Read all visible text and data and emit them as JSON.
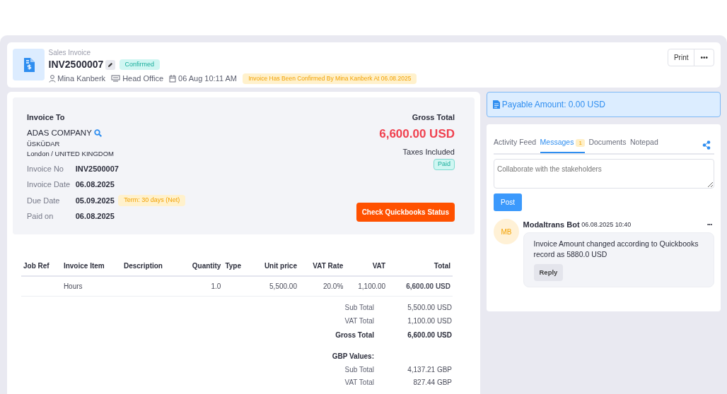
{
  "header": {
    "doc_type": "Sales Invoice",
    "number": "INV2500007",
    "status": "Confirmed",
    "user": "Mina Kanberk",
    "office": "Head Office",
    "datetime": "06 Aug 10:11 AM",
    "notice": "Invoice Has Been Confirmed By Mina Kanberk At 06.08.2025"
  },
  "actions": [
    "Print",
    "•••"
  ],
  "bill_to": {
    "heading": "Invoice To",
    "company": "ADAS COMPANY",
    "lines": [
      "ÜSKÜDAR",
      "London / UNITED KINGDOM"
    ]
  },
  "details": [
    {
      "label": "Invoice No",
      "value": "INV2500007"
    },
    {
      "label": "Invoice Date",
      "value": "06.08.2025"
    },
    {
      "label": "Due Date",
      "value": "05.09.2025",
      "term": "Term:  30 days (Net)"
    },
    {
      "label": "Paid on",
      "value": "06.08.2025"
    }
  ],
  "gross": {
    "heading": "Gross Total",
    "amount": "6,600.00 USD",
    "note": "Taxes Included",
    "payment_status": "Paid",
    "button": "Check Quickbooks Status"
  },
  "table": {
    "columns": [
      "Job Ref",
      "Invoice Item",
      "Description",
      "Quantity",
      "Type",
      "Unit price",
      "VAT Rate",
      "VAT",
      "Total"
    ],
    "rows": [
      [
        "",
        "Hours",
        "",
        "1.0",
        "",
        "5,500.00",
        "20.0%",
        "1,100.00",
        "6,600.00 USD"
      ]
    ]
  },
  "totals": [
    {
      "label": "Sub Total",
      "value": "5,500.00 USD",
      "bold": false
    },
    {
      "label": "VAT Total",
      "value": "1,100.00 USD",
      "bold": false
    },
    {
      "label": "Gross Total",
      "value": "6,600.00 USD",
      "bold": true
    }
  ],
  "gbp": {
    "heading": "GBP Values:",
    "rows": [
      {
        "label": "Sub Total",
        "value": "4,137.21 GBP"
      },
      {
        "label": "VAT Total",
        "value": "827.44 GBP"
      }
    ]
  },
  "payable": "Payable Amount: 0.00 USD",
  "tabs": [
    {
      "label": "Activity Feed",
      "selected": false
    },
    {
      "label": "Messages",
      "selected": true,
      "badge": "1"
    },
    {
      "label": "Documents",
      "selected": false
    },
    {
      "label": "Notepad",
      "selected": false
    }
  ],
  "composer": {
    "placeholder": "Collaborate with the stakeholders",
    "button": "Post"
  },
  "messages": [
    {
      "initials": "MB",
      "author": "Modaltrans Bot",
      "time": "06.08.2025 10:40",
      "menu": "•••",
      "text": "Invoice Amount changed according to Quickbooks record as 5880.0 USD",
      "reply": "Reply"
    }
  ]
}
